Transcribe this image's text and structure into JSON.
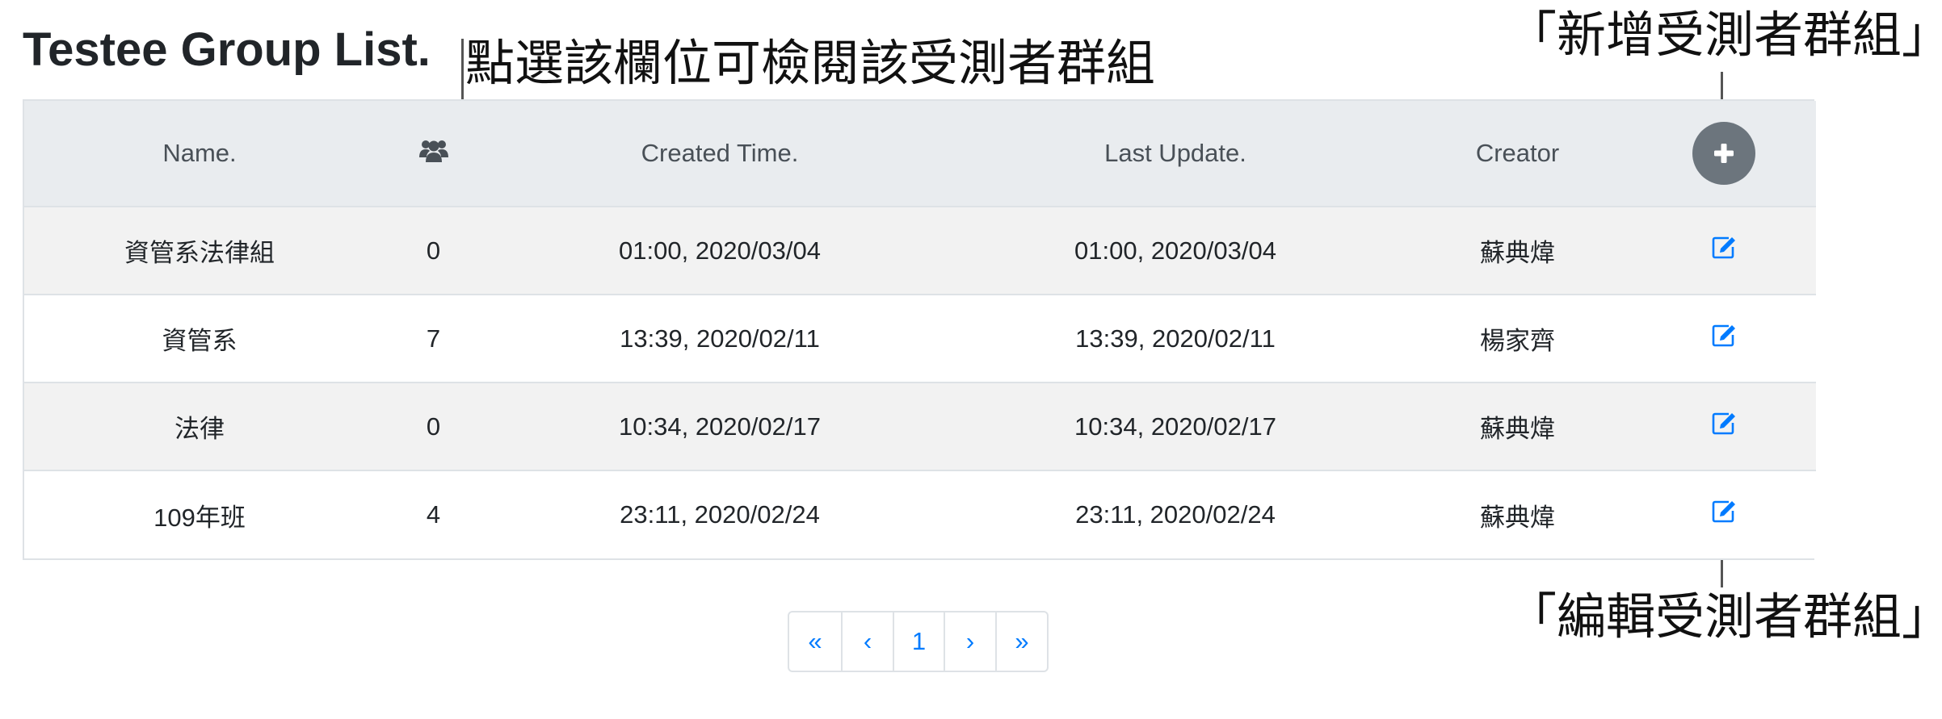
{
  "page": {
    "title": "Testee Group List."
  },
  "annotations": {
    "view_group": "點選該欄位可檢閱該受測者群組",
    "add_group": "「新增受測者群組」",
    "edit_group": "「編輯受測者群組」"
  },
  "table": {
    "headers": {
      "name": "Name.",
      "members_icon": "users-icon",
      "created": "Created Time.",
      "updated": "Last Update.",
      "creator": "Creator"
    },
    "add_button_icon": "plus-icon",
    "edit_icon": "edit-icon",
    "rows": [
      {
        "name": "資管系法律組",
        "count": "0",
        "created": "01:00, 2020/03/04",
        "updated": "01:00, 2020/03/04",
        "creator": "蘇典煒"
      },
      {
        "name": "資管系",
        "count": "7",
        "created": "13:39, 2020/02/11",
        "updated": "13:39, 2020/02/11",
        "creator": "楊家齊"
      },
      {
        "name": "法律",
        "count": "0",
        "created": "10:34, 2020/02/17",
        "updated": "10:34, 2020/02/17",
        "creator": "蘇典煒"
      },
      {
        "name": "109年班",
        "count": "4",
        "created": "23:11, 2020/02/24",
        "updated": "23:11, 2020/02/24",
        "creator": "蘇典煒"
      }
    ]
  },
  "pagination": {
    "first": "«",
    "prev": "‹",
    "current": "1",
    "next": "›",
    "last": "»"
  },
  "colors": {
    "link": "#007bff",
    "header_bg": "#e9ecef",
    "add_button_bg": "#6c757d",
    "striped_row": "#f2f2f2"
  }
}
